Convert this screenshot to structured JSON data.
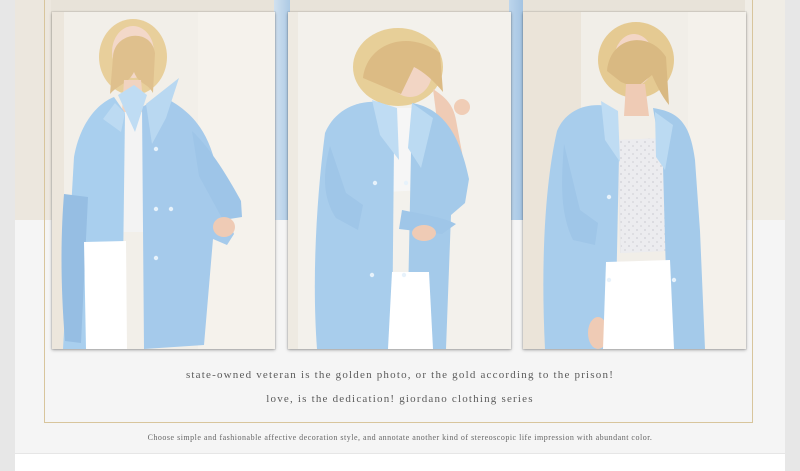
{
  "gallery": {
    "photos": [
      {
        "alt": "Model in light blue trench coat, hand in pocket"
      },
      {
        "alt": "Model in light blue trench coat, touching hair"
      },
      {
        "alt": "Model in light blue trench coat, arms at side"
      }
    ],
    "caption_line_1": "state-owned veteran is the golden photo, or the gold according to the prison!",
    "caption_line_2": "love, is the dedication! giordano clothing series",
    "caption_small": "Choose simple and fashionable affective decoration style, and annotate another kind of stereoscopic life impression with abundant color."
  },
  "colors": {
    "page_bg": "#f5f5f5",
    "frame_gold": "#d8c59c",
    "coat_blue": "#a8cdec",
    "caption_text": "#5b5b5b"
  }
}
